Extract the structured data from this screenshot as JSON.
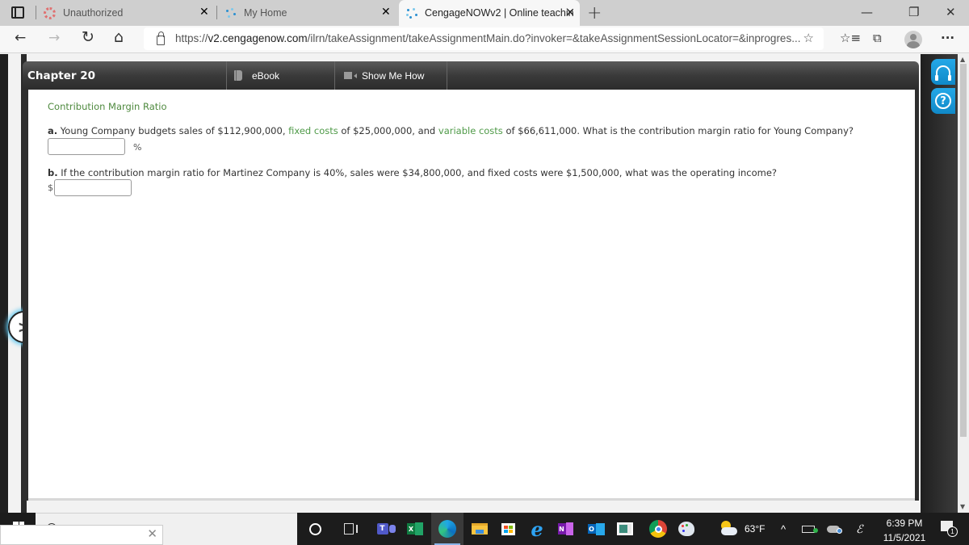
{
  "browser": {
    "tabs": [
      {
        "title": "Unauthorized",
        "favicon": "canvas-icon",
        "active": false
      },
      {
        "title": "My Home",
        "favicon": "cengage-icon",
        "active": false
      },
      {
        "title": "CengageNOWv2 | Online teachin",
        "favicon": "cengage-loading-icon",
        "active": true
      }
    ],
    "new_tab_label": "+",
    "window_controls": {
      "minimize": "—",
      "restore": "❐",
      "close": "✕"
    },
    "url": {
      "scheme": "https://",
      "domain": "v2.cengagenow.com",
      "path": "/ilrn/takeAssignment/takeAssignmentMain.do?invoker=&takeAssignmentSessionLocator=&inprogres..."
    },
    "nav": {
      "back": "←",
      "forward": "→",
      "refresh": "↻",
      "home": "⌂"
    },
    "toolbar": {
      "favorites_add": "☆",
      "favorites": "☆≡",
      "collections": "⧉",
      "more": "···"
    }
  },
  "assignment": {
    "chapter": "Chapter 20",
    "ebook_label": "eBook",
    "show_me_how_label": "Show Me How",
    "section_title": "Contribution Margin Ratio",
    "question_a": {
      "label": "a.",
      "text_1": " Young Company budgets sales of $112,900,000, ",
      "term_1": "fixed costs",
      "text_2": " of $25,000,000, and ",
      "term_2": "variable costs",
      "text_3": " of $66,611,000. What is the contribution margin ratio for Young Company?",
      "answer_value": "",
      "unit": "%"
    },
    "question_b": {
      "label": "b.",
      "text": " If the contribution margin ratio for Martinez Company is 40%, sales were $34,800,000, and fixed costs were $1,500,000, what was the operating income?",
      "answer_value": "",
      "prefix": "$"
    },
    "next_label": ">",
    "help_qmark": "?"
  },
  "taskbar": {
    "apps": [
      "cortana-icon",
      "task-view-icon",
      "teams-icon",
      "excel-icon",
      "edge-icon",
      "file-explorer-icon",
      "store-icon",
      "internet-explorer-icon",
      "onenote-icon",
      "outlook-icon",
      "news-icon",
      "chrome-icon",
      "paint-icon"
    ],
    "weather": "63°F",
    "time": "6:39 PM",
    "date": "11/5/2021",
    "notification_count": "1",
    "search_close": "✕"
  },
  "colors": {
    "term_green": "#4f9a48",
    "section_green": "#4f8a3f",
    "help_blue": "#1a9ad8",
    "chapter_bar": "#3a3a3a"
  }
}
